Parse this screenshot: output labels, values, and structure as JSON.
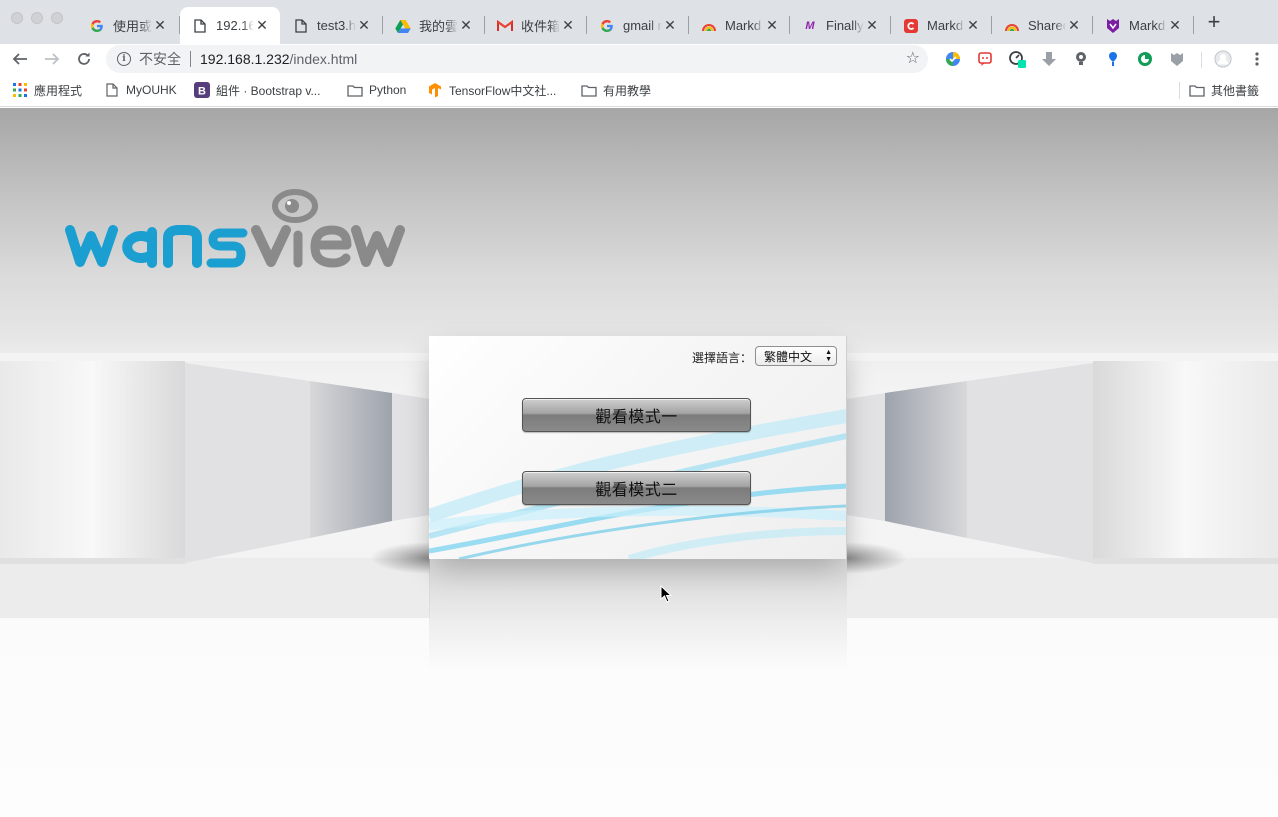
{
  "browser": {
    "tabs": [
      {
        "label": "使用或",
        "favicon": "google-icon",
        "active": false
      },
      {
        "label": "192.16",
        "favicon": "page-icon",
        "active": true
      },
      {
        "label": "test3.h",
        "favicon": "page-icon",
        "active": false
      },
      {
        "label": "我的雲",
        "favicon": "google-drive-icon",
        "active": false
      },
      {
        "label": "收件箱",
        "favicon": "gmail-icon",
        "active": false
      },
      {
        "label": "gmail r",
        "favicon": "google-icon",
        "active": false
      },
      {
        "label": "Markd",
        "favicon": "rainbow-icon",
        "active": false
      },
      {
        "label": "Finally",
        "favicon": "m-logo-icon",
        "active": false
      },
      {
        "label": "Markd",
        "favicon": "red-logo-icon",
        "active": false
      },
      {
        "label": "Shared",
        "favicon": "rainbow-icon",
        "active": false
      },
      {
        "label": "Markd",
        "favicon": "purple-shield-icon",
        "active": false
      }
    ],
    "omnibox": {
      "security_label": "不安全",
      "url_host": "192.168.1.232",
      "url_path": "/index.html"
    },
    "bookmarks": [
      {
        "label": "應用程式",
        "icon": "apps-grid-icon"
      },
      {
        "label": "MyOUHK",
        "icon": "page-icon"
      },
      {
        "label": "組件 · Bootstrap v...",
        "icon": "bootstrap-icon"
      },
      {
        "label": "Python",
        "icon": "folder-icon"
      },
      {
        "label": "TensorFlow中文社...",
        "icon": "tensorflow-icon"
      },
      {
        "label": "有用教學",
        "icon": "folder-icon"
      }
    ],
    "other_bookmarks": "其他書籤"
  },
  "app": {
    "brand_colors": {
      "primary": "#1b9fd1",
      "secondary": "#8a8a8a"
    },
    "language_label": "選擇語言：",
    "language_selected": "繁體中文",
    "mode_buttons": [
      "觀看模式一",
      "觀看模式二"
    ]
  }
}
